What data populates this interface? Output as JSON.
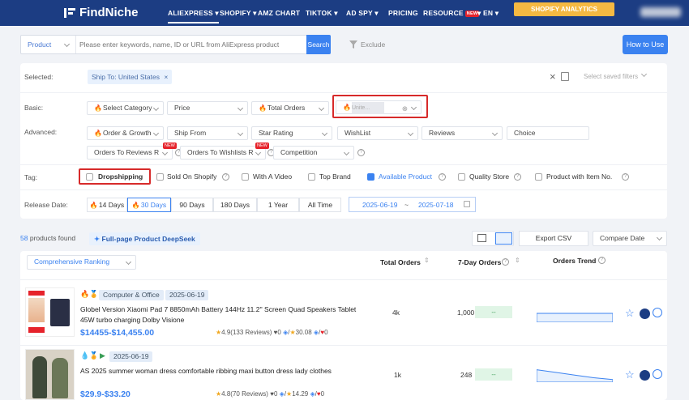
{
  "header": {
    "logo": "FindNiche",
    "nav": [
      {
        "label": "ALIEXPRESS ▾"
      },
      {
        "label": "SHOPIFY ▾"
      },
      {
        "label": "AMZ CHART"
      },
      {
        "label": "TIKTOK ▾"
      },
      {
        "label": "AD SPY ▾"
      },
      {
        "label": "PRICING"
      },
      {
        "label": "RESOURCE",
        "badge": "NEW"
      },
      {
        "label": "▾  EN ▾"
      }
    ],
    "cta": "SHOPIFY ANALYTICS"
  },
  "search": {
    "type_label": "Product",
    "placeholder": "Please enter keywords, name, ID or URL from AliExpress product",
    "button": "Search",
    "exclude": "Exclude",
    "how_to": "How to Use"
  },
  "filters": {
    "selected_label": "Selected:",
    "selected_chip": "Ship To: United States",
    "saved_placeholder": "Select saved filters",
    "basic_label": "Basic:",
    "basic": [
      "Select Category",
      "Price",
      "Total Orders",
      "Unite..."
    ],
    "advanced_label": "Advanced:",
    "advanced_row1": [
      "Order & Growth",
      "Ship From",
      "Star Rating",
      "WishList",
      "Reviews",
      "Choice"
    ],
    "advanced_row2": [
      "Orders To Reviews R",
      "Orders To Wishlists R",
      "Competition"
    ],
    "new_badge": "NEW",
    "tag_label": "Tag:",
    "tags": [
      {
        "label": "Dropshipping",
        "checked": false
      },
      {
        "label": "Sold On Shopify",
        "checked": false
      },
      {
        "label": "With A Video",
        "checked": false
      },
      {
        "label": "Top Brand",
        "checked": false
      },
      {
        "label": "Available Product",
        "checked": true
      },
      {
        "label": "Quality Store",
        "checked": false
      },
      {
        "label": "Product with Item No.",
        "checked": false
      }
    ],
    "release_label": "Release Date:",
    "release_opts": [
      "14 Days",
      "30 Days",
      "90 Days",
      "180 Days",
      "1 Year",
      "All Time"
    ],
    "date_from": "2025-06-19",
    "date_sep": "~",
    "date_to": "2025-07-18"
  },
  "results": {
    "count": "58",
    "count_suffix": "products found",
    "deepseek": "Full-page Product DeepSeek",
    "export": "Export CSV",
    "sort": "Compare Date"
  },
  "table": {
    "ranking": "Comprehensive Ranking",
    "col_total": "Total Orders",
    "col_7day": "7-Day Orders",
    "col_trend": "Orders Trend",
    "rows": [
      {
        "category": "Computer & Office",
        "date": "2025-06-19",
        "title": "Globel Version Xiaomi Pad 7 8850mAh Battery 144Hz 11.2'' Screen Quad Speakers Tablet 45W turbo charging Dolby Visione",
        "price": "$14455-$14,455.00",
        "rating": "4.9(133 Reviews)",
        "hearts": "0",
        "score": "30.08",
        "likes": "0",
        "total": "4k",
        "seven": "1,000",
        "growth": "--",
        "trend": [
          0.5,
          0.5,
          0.5,
          0.5,
          0.5
        ]
      },
      {
        "category": "",
        "date": "2025-06-19",
        "title": "AS 2025 summer woman dress comfortable ribbing maxi button dress lady clothes",
        "price": "$29.9-$33.20",
        "rating": "4.8(70 Reviews)",
        "hearts": "0",
        "score": "14.29",
        "likes": "0",
        "total": "1k",
        "seven": "248",
        "growth": "--",
        "trend": [
          0.7,
          0.55,
          0.4,
          0.25,
          0.15
        ]
      }
    ]
  },
  "colors": {
    "accent": "#3b82f0",
    "nav_bg": "#1c3d83",
    "cta": "#f5b942",
    "highlight": "#d72a2a"
  }
}
